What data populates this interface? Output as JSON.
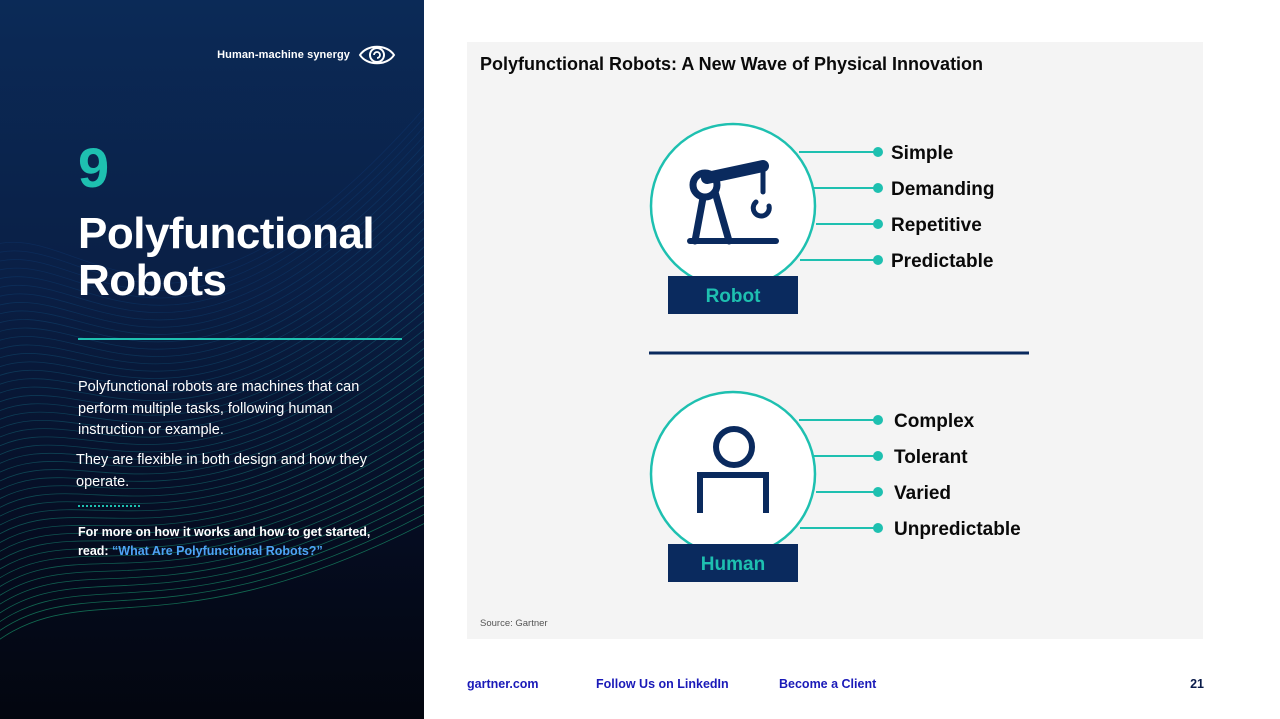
{
  "left": {
    "section_tag": "Human-machine synergy",
    "section_icon": "eye-icon",
    "number": "9",
    "title": "Polyfunctional Robots",
    "paragraph_1": "Polyfunctional robots are machines that can perform multiple tasks, following human instruction or example.",
    "paragraph_2": "They are flexible in both design and how they operate.",
    "more_prefix": "For more on how it works and how to get started, read: ",
    "more_link": "“What Are Polyfunctional Robots?”"
  },
  "figure": {
    "title": "Polyfunctional Robots: A New Wave of Physical Innovation",
    "robot": {
      "label": "Robot",
      "icon": "robot-arm-icon",
      "traits": [
        "Simple",
        "Demanding",
        "Repetitive",
        "Predictable"
      ]
    },
    "human": {
      "label": "Human",
      "icon": "person-icon",
      "traits": [
        "Complex",
        "Tolerant",
        "Varied",
        "Unpredictable"
      ]
    },
    "source": "Source: Gartner"
  },
  "footer": {
    "links": [
      "gartner.com",
      "Follow Us on LinkedIn",
      "Become a Client"
    ],
    "page_number": "21"
  },
  "colors": {
    "teal": "#1ec0b0",
    "navy": "#0a2a5e",
    "link_blue": "#1a1ab8",
    "quote_link_blue": "#4ea3f5"
  }
}
